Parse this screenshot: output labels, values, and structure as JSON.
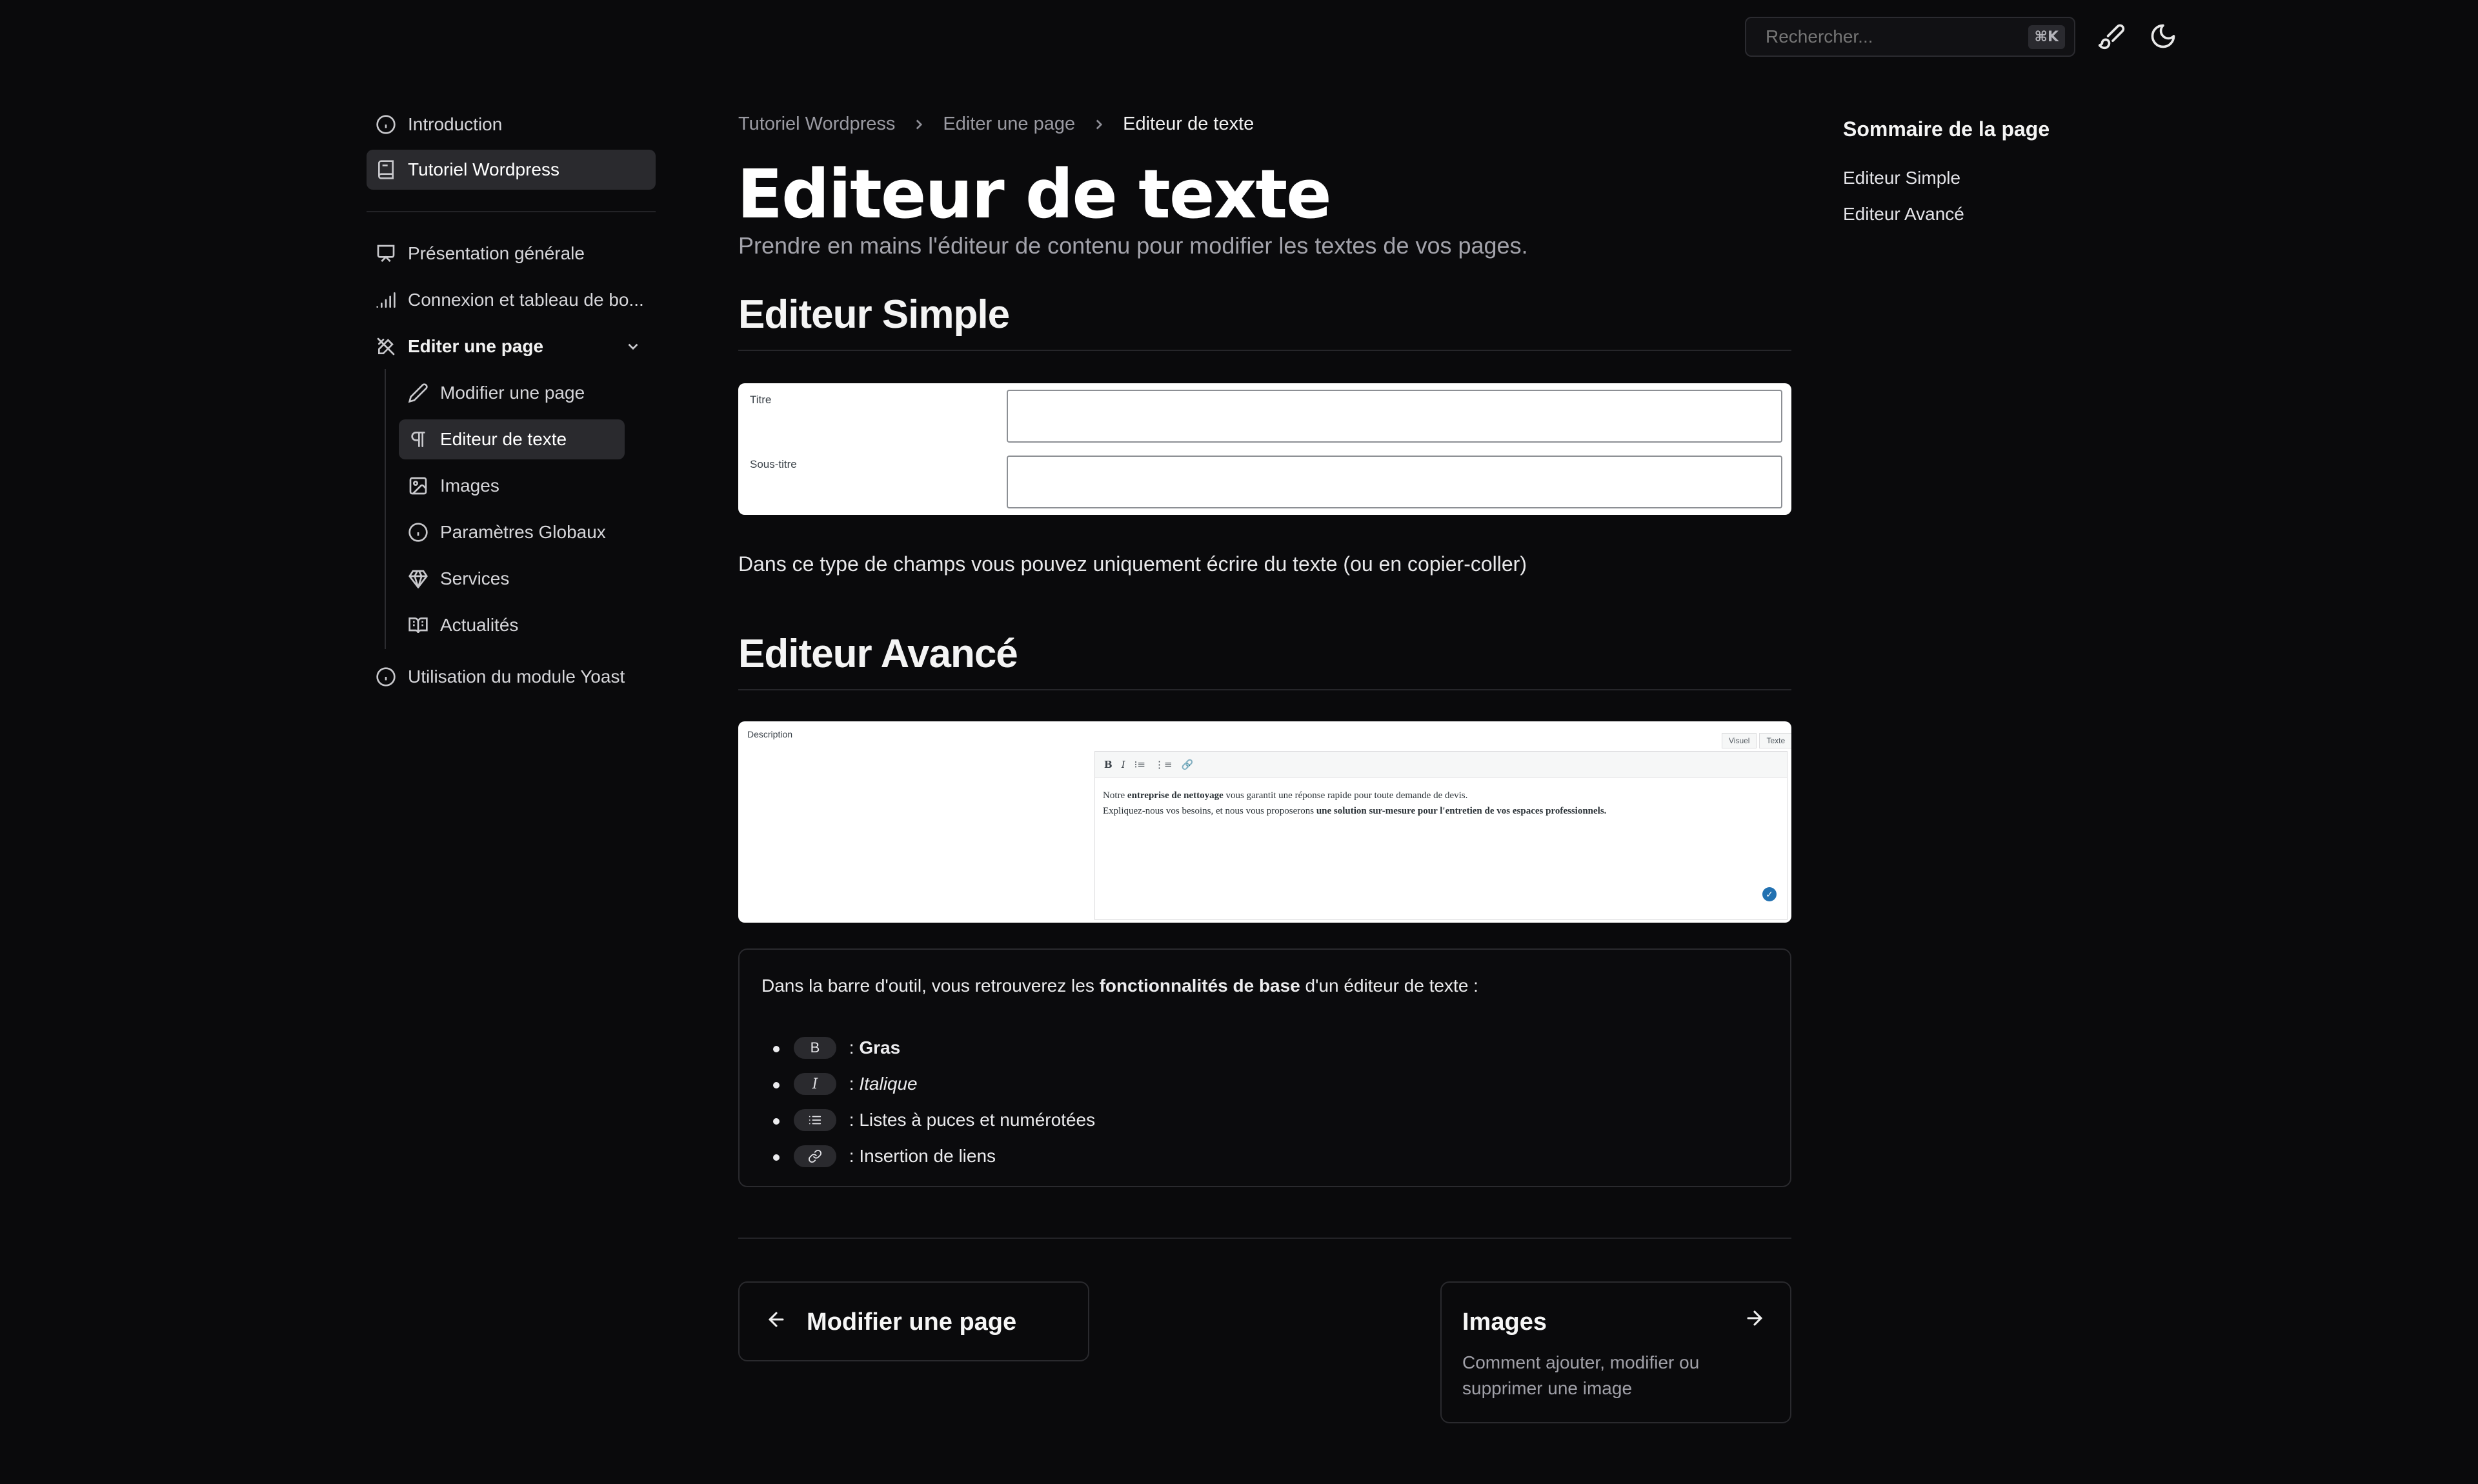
{
  "search": {
    "placeholder": "Rechercher...",
    "shortcut": "⌘K"
  },
  "topbar": {
    "icons": [
      "brush-icon",
      "moon-icon"
    ]
  },
  "sidebar": {
    "top_items": [
      {
        "label": "Introduction",
        "icon": "info-icon"
      },
      {
        "label": "Tutoriel Wordpress",
        "icon": "book-icon",
        "active": true
      }
    ],
    "items": [
      {
        "label": "Présentation générale",
        "icon": "presentation-icon"
      },
      {
        "label": "Connexion et tableau de bo...",
        "icon": "signal-icon"
      },
      {
        "label": "Editer une page",
        "icon": "pen-ruler-icon",
        "expanded": true
      },
      {
        "label": "Modifier une page",
        "icon": "pencil-icon"
      },
      {
        "label": "Editeur de texte",
        "icon": "pilcrow-icon",
        "active": true
      },
      {
        "label": "Images",
        "icon": "image-icon"
      },
      {
        "label": "Paramètres Globaux",
        "icon": "info-icon"
      },
      {
        "label": "Services",
        "icon": "gem-icon"
      },
      {
        "label": "Actualités",
        "icon": "newspaper-icon"
      },
      {
        "label": "Utilisation du module Yoast",
        "icon": "info-icon"
      }
    ]
  },
  "breadcrumb": [
    "Tutoriel Wordpress",
    "Editer une page",
    "Editeur de texte"
  ],
  "page": {
    "title": "Editeur de texte",
    "subtitle": "Prendre en mains l'éditeur de contenu pour modifier les textes de vos pages."
  },
  "simple": {
    "heading": "Editeur Simple",
    "field1": "Titre",
    "field2": "Sous-titre",
    "note": "Dans ce type de champs vous pouvez uniquement écrire du texte (ou en copier-coller)"
  },
  "advanced": {
    "heading": "Editeur Avancé",
    "field_label": "Description",
    "tab_visual": "Visuel",
    "tab_text": "Texte",
    "toolbar": [
      "B",
      "I",
      "⁝≡",
      "⋮≡",
      "🔗"
    ],
    "line1_pre": "Notre ",
    "line1_bold": "entreprise de nettoyage",
    "line1_post": " vous garantit une réponse rapide pour toute demande de devis.",
    "line2_pre": "Expliquez-nous vos besoins, et nous vous proposerons ",
    "line2_bold": "une solution sur-mesure pour l'entretien de vos espaces professionnels."
  },
  "info": {
    "intro_pre": "Dans la barre d'outil, vous retrouverez les ",
    "intro_bold": "fonctionnalités de base",
    "intro_post": " d'un éditeur de texte :",
    "items": [
      {
        "pill": "B",
        "text": "Gras"
      },
      {
        "pill": "I",
        "text": "Italique"
      },
      {
        "pill": "list-icon",
        "text": "Listes à puces et numérotées"
      },
      {
        "pill": "link-icon",
        "text": "Insertion de liens"
      }
    ],
    "sep": " : "
  },
  "nav": {
    "prev": {
      "title": "Modifier une page"
    },
    "next": {
      "title": "Images",
      "desc": "Comment ajouter, modifier ou supprimer une image"
    }
  },
  "toc": {
    "title": "Sommaire de la page",
    "items": [
      "Editeur Simple",
      "Editeur Avancé"
    ]
  }
}
